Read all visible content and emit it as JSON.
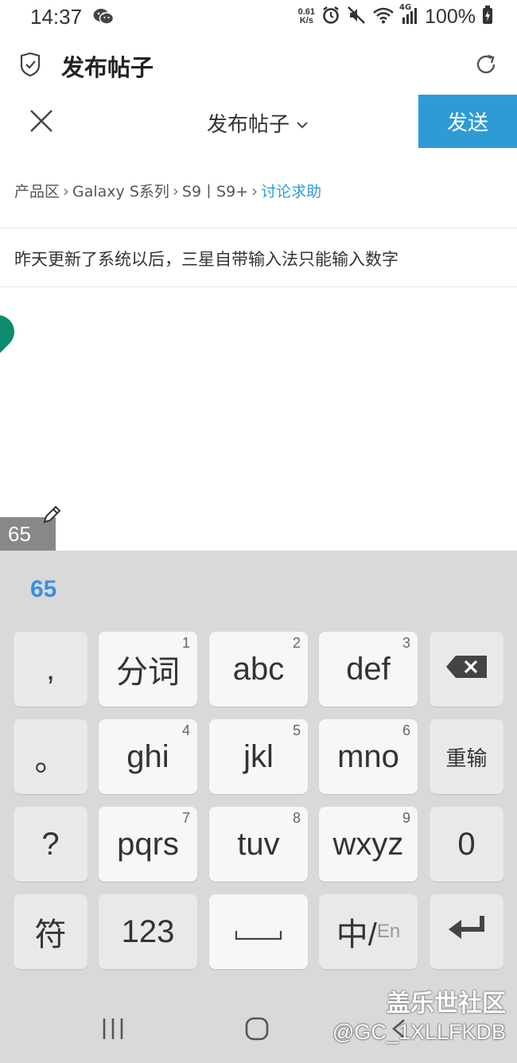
{
  "status_bar": {
    "time": "14:37",
    "net_speed_value": "0.61",
    "net_speed_unit": "K/s",
    "network": "4G",
    "battery": "100%"
  },
  "app_header": {
    "title": "发布帖子"
  },
  "compose": {
    "title": "发布帖子",
    "send_label": "发送"
  },
  "breadcrumb": {
    "items": [
      "产品区",
      "Galaxy S系列",
      "S9丨S9+",
      "讨论求助"
    ]
  },
  "post": {
    "title": "昨天更新了系统以后，三星自带输入法只能输入数字"
  },
  "composing_text": "65",
  "keyboard": {
    "candidate": "65",
    "rows": [
      [
        {
          "label": ",",
          "num": ""
        },
        {
          "label": "分词",
          "num": "1"
        },
        {
          "label": "abc",
          "num": "2"
        },
        {
          "label": "def",
          "num": "3"
        },
        {
          "label": "",
          "num": ""
        }
      ],
      [
        {
          "label": "。",
          "num": ""
        },
        {
          "label": "ghi",
          "num": "4"
        },
        {
          "label": "jkl",
          "num": "5"
        },
        {
          "label": "mno",
          "num": "6"
        },
        {
          "label": "重输",
          "num": ""
        }
      ],
      [
        {
          "label": "?",
          "num": ""
        },
        {
          "label": "pqrs",
          "num": "7"
        },
        {
          "label": "tuv",
          "num": "8"
        },
        {
          "label": "wxyz",
          "num": "9"
        },
        {
          "label": "0",
          "num": ""
        }
      ],
      [
        {
          "label": "符",
          "num": ""
        },
        {
          "label": "123",
          "num": ""
        },
        {
          "label": "",
          "num": ""
        },
        {
          "label": "中/",
          "num": "",
          "sub": "En"
        },
        {
          "label": "",
          "num": ""
        }
      ]
    ]
  },
  "watermark": {
    "brand": "盖乐世社区",
    "user": "@GC_1XLLFKDB"
  },
  "colors": {
    "accent": "#2e9bd6",
    "candidate": "#3b8fe0",
    "cursor_handle": "#0e8a6e",
    "keyboard_bg": "#d9d9d9"
  },
  "icons": {
    "app_header_left": "shield-check-icon",
    "app_header_right": "refresh-icon",
    "compose_left": "close-icon",
    "compose_title_suffix": "chevron-down-icon",
    "backspace": "backspace-icon",
    "space": "space-bar-icon",
    "enter": "enter-icon"
  }
}
